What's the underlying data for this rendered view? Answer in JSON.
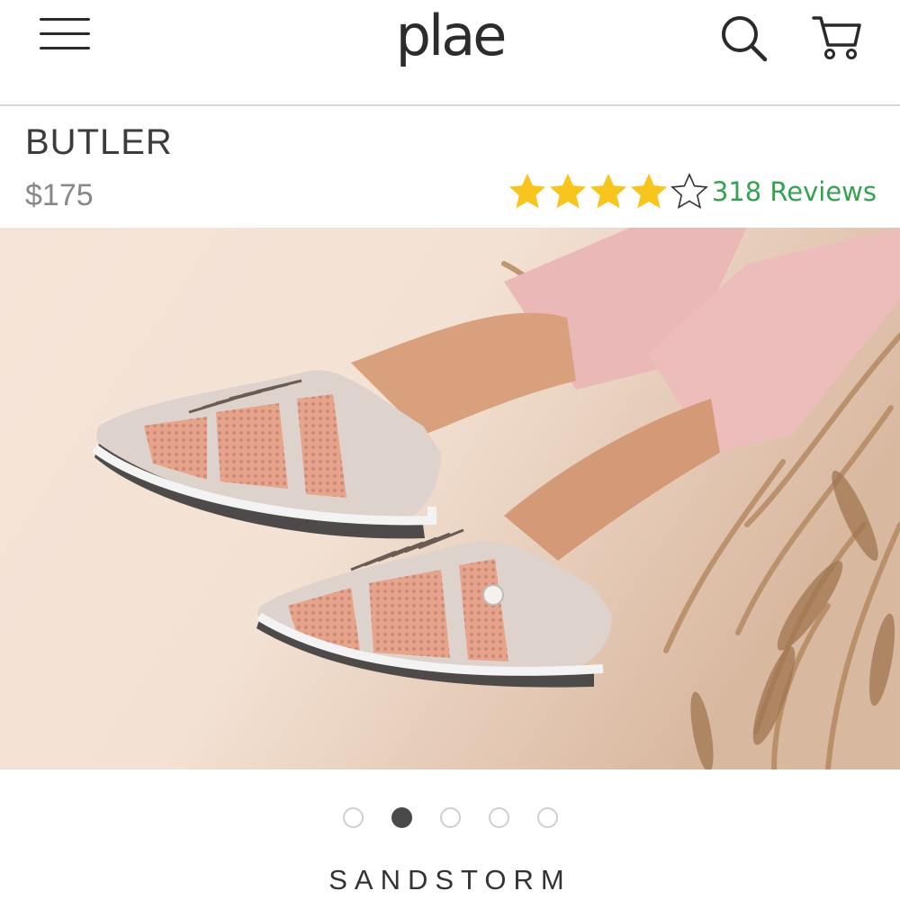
{
  "header": {
    "logo": "plae",
    "menu_icon": "hamburger-menu-icon",
    "search_icon": "search-icon",
    "cart_icon": "cart-icon"
  },
  "product": {
    "name": "BUTLER",
    "price": "$175",
    "rating": {
      "stars_filled": 4,
      "stars_total": 5,
      "reviews_label": "318 Reviews"
    },
    "image_description_icon": "product-photo",
    "color_name": "SANDSTORM"
  },
  "carousel": {
    "total": 5,
    "active_index": 1
  },
  "colors": {
    "star": "#f7c51e",
    "reviews": "#34a24f",
    "dot_active": "#4a4a4a",
    "dot_inactive": "#cfcfcf"
  }
}
